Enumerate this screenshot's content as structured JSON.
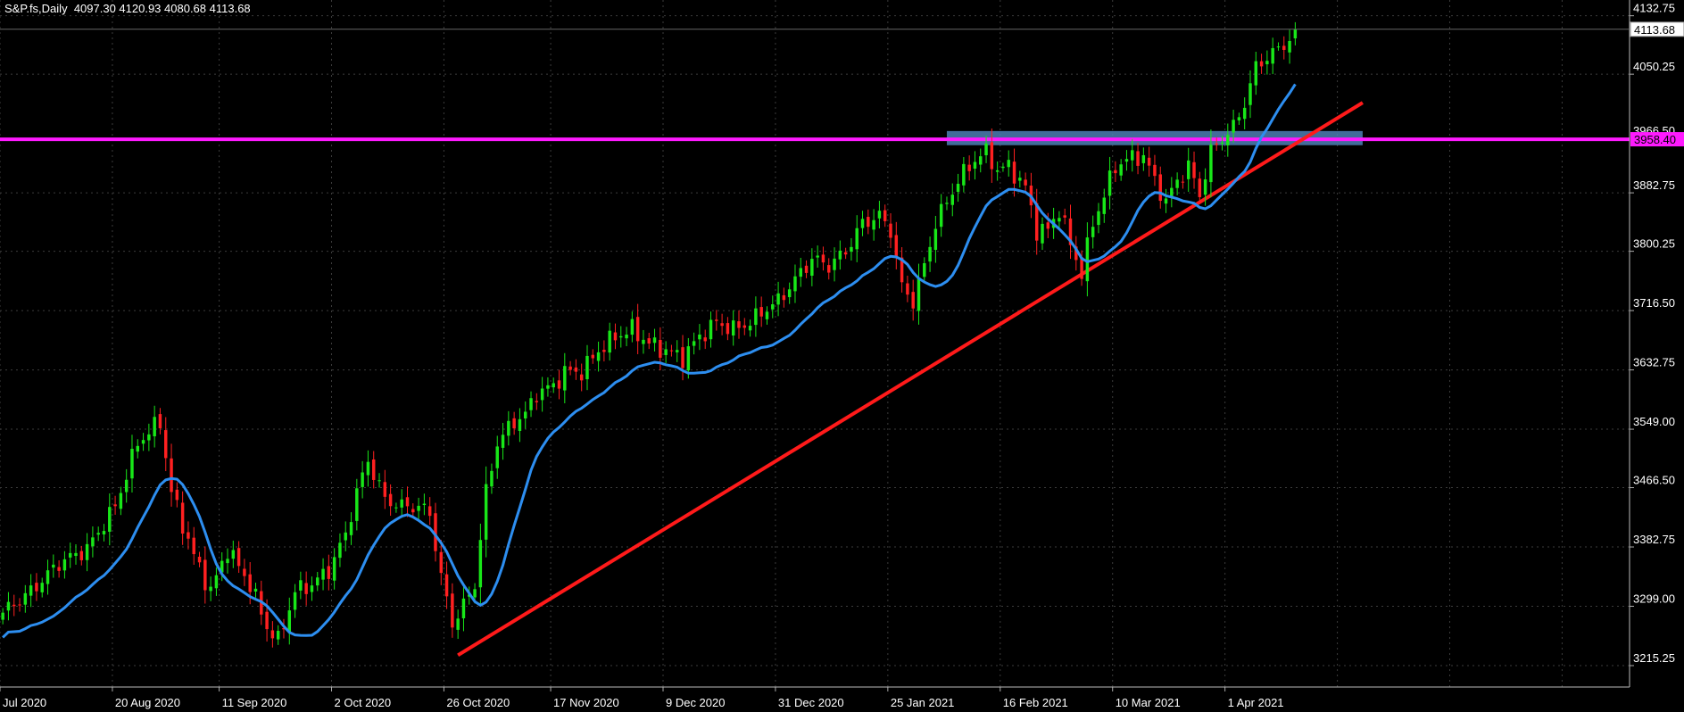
{
  "header": {
    "symbol": "S&P.fs,Daily",
    "ohlc": "4097.30 4120.93 4080.68 4113.68"
  },
  "colors": {
    "background": "#000000",
    "grid": "#3c3c3c",
    "bull": "#18e718",
    "bear": "#ff2020",
    "ma": "#2d8ef0",
    "trendline": "#ff1a1a",
    "resistance": "#ff1aff",
    "zone": "#4d7fb5",
    "axis_text": "#ffffff"
  },
  "chart_data": {
    "type": "candlestick",
    "ylim": [
      3185,
      4155
    ],
    "y_ticks": [
      3215.25,
      3299.0,
      3382.75,
      3466.5,
      3549.0,
      3632.75,
      3716.5,
      3800.25,
      3882.75,
      4050.25,
      4132.75
    ],
    "x_tick_labels": [
      "Jul 2020",
      "20 Aug 2020",
      "11 Sep 2020",
      "2 Oct 2020",
      "26 Oct 2020",
      "17 Nov 2020",
      "9 Dec 2020",
      "31 Dec 2020",
      "25 Jan 2021",
      "16 Feb 2021",
      "10 Mar 2021",
      "1 Apr 2021"
    ],
    "x_tick_bars": [
      0,
      20,
      39,
      59,
      79,
      98,
      118,
      138,
      158,
      178,
      198,
      218
    ],
    "total_slots": 290,
    "last_price": 4113.68,
    "level_price": 3958.4,
    "level_label": "3958.40",
    "partial_level_label": "3966.50",
    "zone": {
      "from_bar": 168,
      "to_bar": 242,
      "low": 3950,
      "high": 3970
    },
    "trendline": {
      "start_bar": 81,
      "start_price": 3230,
      "end_bar": 242,
      "end_price": 4010
    },
    "ma_period": 10,
    "anchors": [
      [
        0,
        3290
      ],
      [
        5,
        3320
      ],
      [
        10,
        3360
      ],
      [
        15,
        3380
      ],
      [
        20,
        3440
      ],
      [
        24,
        3530
      ],
      [
        28,
        3560
      ],
      [
        30,
        3460
      ],
      [
        34,
        3370
      ],
      [
        37,
        3320
      ],
      [
        40,
        3380
      ],
      [
        44,
        3330
      ],
      [
        47,
        3270
      ],
      [
        49,
        3250
      ],
      [
        52,
        3320
      ],
      [
        55,
        3330
      ],
      [
        58,
        3350
      ],
      [
        61,
        3400
      ],
      [
        63,
        3460
      ],
      [
        65,
        3505
      ],
      [
        68,
        3450
      ],
      [
        71,
        3440
      ],
      [
        74,
        3440
      ],
      [
        76,
        3430
      ],
      [
        78,
        3340
      ],
      [
        80,
        3275
      ],
      [
        82,
        3300
      ],
      [
        84,
        3330
      ],
      [
        86,
        3460
      ],
      [
        88,
        3530
      ],
      [
        91,
        3560
      ],
      [
        93,
        3570
      ],
      [
        95,
        3600
      ],
      [
        98,
        3610
      ],
      [
        100,
        3630
      ],
      [
        103,
        3630
      ],
      [
        106,
        3660
      ],
      [
        109,
        3680
      ],
      [
        112,
        3690
      ],
      [
        115,
        3670
      ],
      [
        118,
        3660
      ],
      [
        121,
        3650
      ],
      [
        124,
        3680
      ],
      [
        127,
        3700
      ],
      [
        130,
        3690
      ],
      [
        133,
        3700
      ],
      [
        136,
        3720
      ],
      [
        138,
        3730
      ],
      [
        141,
        3760
      ],
      [
        144,
        3790
      ],
      [
        147,
        3780
      ],
      [
        150,
        3800
      ],
      [
        153,
        3840
      ],
      [
        156,
        3850
      ],
      [
        158,
        3830
      ],
      [
        160,
        3750
      ],
      [
        162,
        3730
      ],
      [
        164,
        3780
      ],
      [
        166,
        3840
      ],
      [
        168,
        3870
      ],
      [
        170,
        3900
      ],
      [
        173,
        3930
      ],
      [
        175,
        3940
      ],
      [
        177,
        3915
      ],
      [
        179,
        3920
      ],
      [
        182,
        3890
      ],
      [
        184,
        3830
      ],
      [
        186,
        3830
      ],
      [
        188,
        3860
      ],
      [
        190,
        3810
      ],
      [
        192,
        3770
      ],
      [
        194,
        3840
      ],
      [
        196,
        3880
      ],
      [
        198,
        3920
      ],
      [
        200,
        3930
      ],
      [
        203,
        3935
      ],
      [
        205,
        3900
      ],
      [
        207,
        3870
      ],
      [
        209,
        3900
      ],
      [
        211,
        3920
      ],
      [
        213,
        3880
      ],
      [
        215,
        3940
      ],
      [
        217,
        3960
      ],
      [
        219,
        3975
      ],
      [
        221,
        4010
      ],
      [
        223,
        4060
      ],
      [
        225,
        4075
      ],
      [
        227,
        4085
      ],
      [
        229,
        4100
      ],
      [
        230,
        4113.68
      ]
    ]
  }
}
